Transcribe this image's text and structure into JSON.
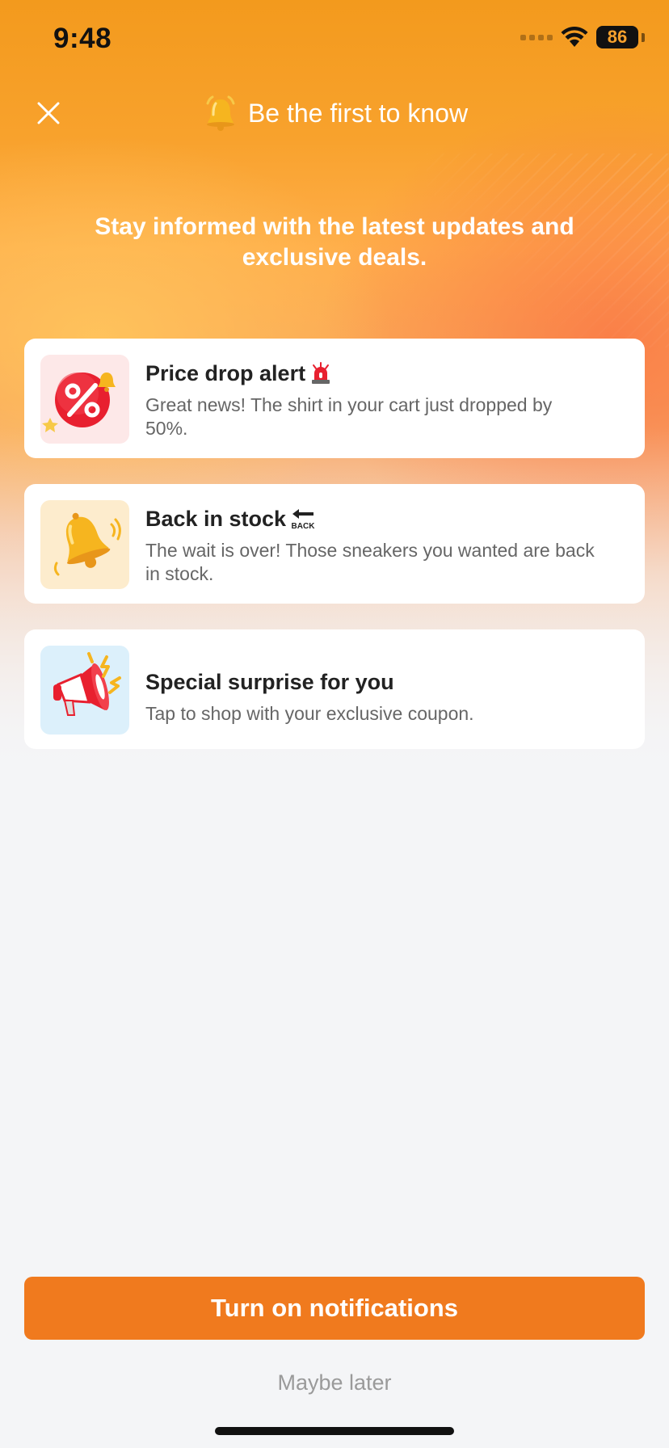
{
  "status_bar": {
    "time": "9:48",
    "battery": "86"
  },
  "header": {
    "title": "Be the first to know",
    "close_icon": "close-icon",
    "title_icon": "bell-icon"
  },
  "subtitle": "Stay informed with the latest updates and exclusive deals.",
  "cards": [
    {
      "title": "Price drop alert",
      "title_icon": "siren-icon",
      "description": "Great news! The shirt in your cart just dropped by 50%.",
      "icon": "percent-badge-icon",
      "icon_bg": "#fde8e8"
    },
    {
      "title": "Back in stock",
      "title_icon": "back-arrow-icon",
      "title_icon_text": "BACK",
      "description": "The wait is over! Those sneakers you wanted are back in stock.",
      "icon": "ringing-bell-icon",
      "icon_bg": "#fdeccd"
    },
    {
      "title": "Special surprise for you",
      "description": "Tap to shop with your exclusive coupon.",
      "icon": "megaphone-icon",
      "icon_bg": "#dcf0fb"
    }
  ],
  "actions": {
    "primary": "Turn on notifications",
    "secondary": "Maybe later"
  },
  "colors": {
    "accent": "#f07a1e",
    "hero_top": "#f39a1d"
  }
}
